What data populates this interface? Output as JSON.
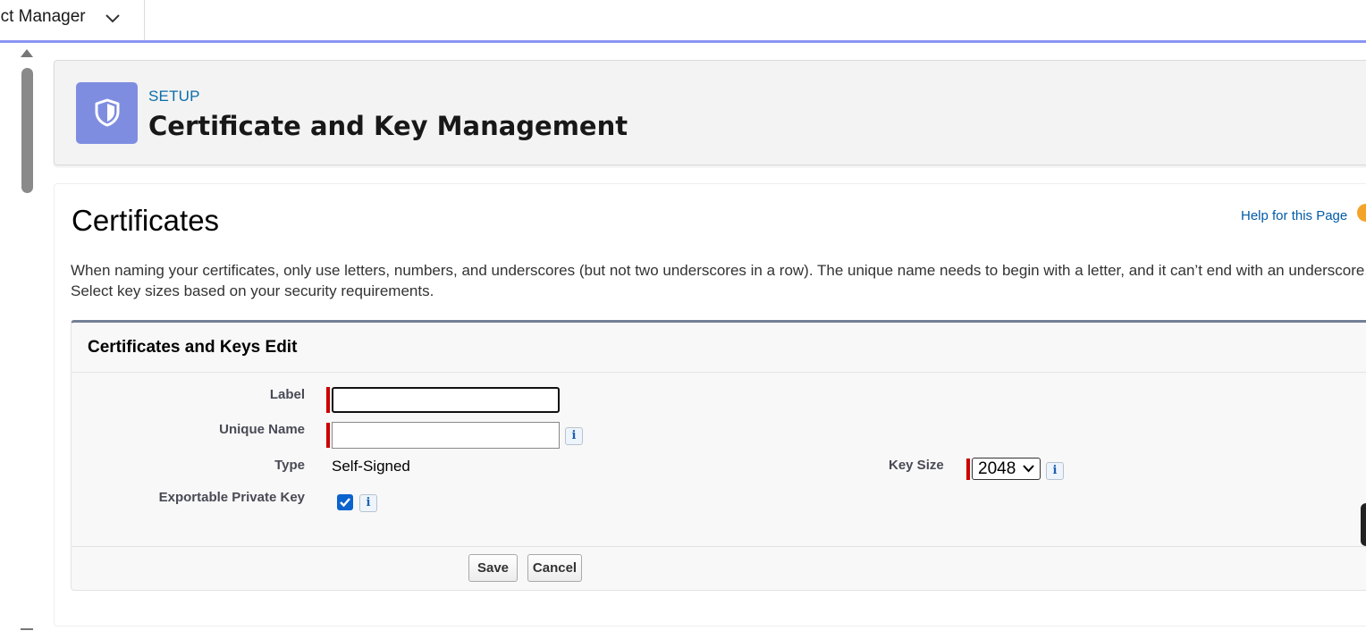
{
  "app": {
    "name": "ect Manager"
  },
  "header": {
    "eyebrow": "SETUP",
    "title": "Certificate and Key Management"
  },
  "section": {
    "title": "Certificates",
    "help_link": "Help for this Page",
    "intro": "When naming your certificates, only use letters, numbers, and underscores (but not two underscores in a row). The unique name needs to begin with a letter, and it can’t end with an underscore. Select key sizes based on your security requirements."
  },
  "edit": {
    "title": "Certificates and Keys Edit",
    "fields": {
      "label": {
        "label": "Label",
        "value": ""
      },
      "unique_name": {
        "label": "Unique Name",
        "value": ""
      },
      "type": {
        "label": "Type",
        "value": "Self-Signed"
      },
      "exportable": {
        "label": "Exportable Private Key",
        "checked": true
      },
      "key_size": {
        "label": "Key Size",
        "value": "2048"
      }
    },
    "info_glyph": "i",
    "buttons": {
      "save": "Save",
      "cancel": "Cancel"
    }
  },
  "colors": {
    "accent": "#8b94f4",
    "icon_bg": "#7f8de1",
    "link": "#0b6ea9",
    "required": "#cc0000",
    "checkbox": "#0b63ce"
  },
  "icons": {
    "app_dropdown": "chevron-down-icon",
    "header": "shield-icon",
    "help": "help-icon",
    "info": "info-icon"
  }
}
